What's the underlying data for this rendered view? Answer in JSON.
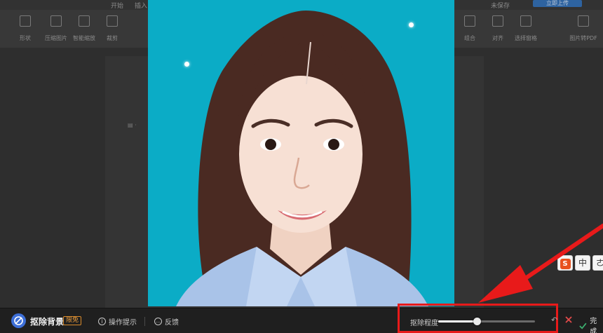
{
  "ribbon": {
    "tabs": [
      "开始",
      "插入"
    ],
    "tools": [
      "形状",
      "压缩图片",
      "智能缩放",
      "裁剪",
      "组合",
      "对齐",
      "选择窗格",
      "图片转PDF"
    ],
    "upload_label": "立即上传",
    "save_status": "未保存"
  },
  "ime": {
    "logo": "S",
    "mode": "中"
  },
  "toolbar": {
    "title": "抠除背景",
    "badge": "限免",
    "hint_label": "操作提示",
    "feedback_label": "反馈",
    "slider_label": "抠除程度",
    "slider_value": 0.4,
    "done_label": "完成"
  },
  "colors": {
    "photo_background": "#0bacc6",
    "accent": "#3d6fd8",
    "highlight": "#e81a1a",
    "done_check": "#3cb371"
  }
}
